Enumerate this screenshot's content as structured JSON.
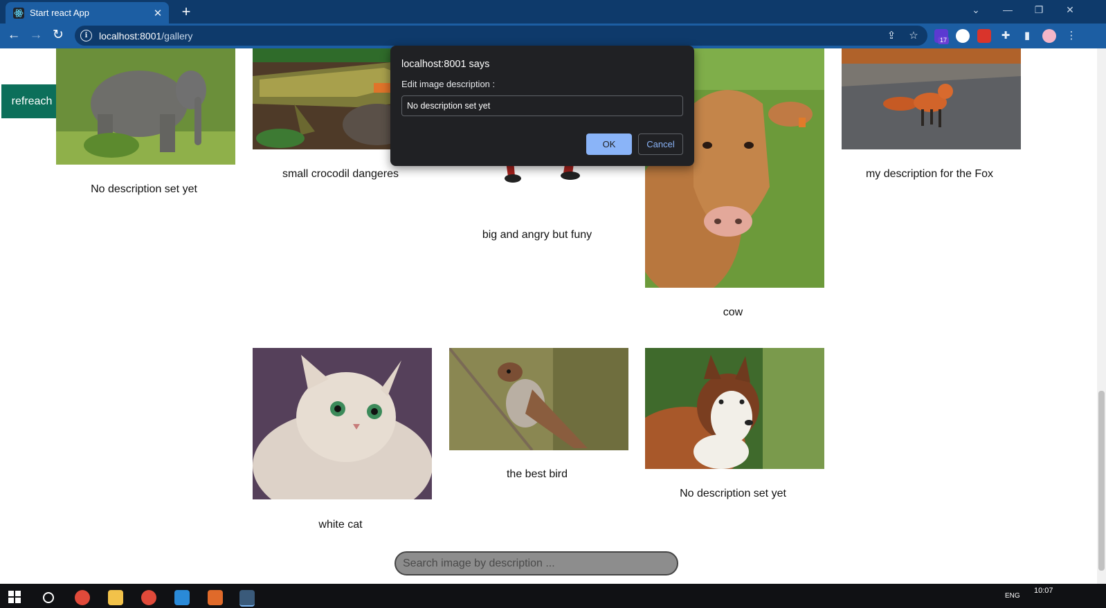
{
  "browser": {
    "tab_title": "Start react App",
    "tab_close": "✕",
    "new_tab": "+",
    "url_host": "localhost:8001",
    "url_path": "/gallery",
    "extension_badge": "17"
  },
  "page": {
    "refresh_label": "refreach",
    "search_placeholder": "Search image by description ...",
    "gallery": [
      {
        "caption": "No description set yet",
        "subject": "elephant"
      },
      {
        "caption": "small crocodil dangeres",
        "subject": "crocodile"
      },
      {
        "caption": "big and angry but funy",
        "subject": "cartoon"
      },
      {
        "caption": "cow",
        "subject": "cow"
      },
      {
        "caption": "my description for the Fox",
        "subject": "fox"
      },
      {
        "caption": "white cat",
        "subject": "cat"
      },
      {
        "caption": "the best bird",
        "subject": "sparrow"
      },
      {
        "caption": "No description set yet",
        "subject": "husky"
      }
    ]
  },
  "dialog": {
    "title": "localhost:8001 says",
    "message": "Edit image description :",
    "input_value": "No description set yet",
    "ok_label": "OK",
    "cancel_label": "Cancel"
  },
  "taskbar": {
    "clock": "10:07",
    "lang": "ENG"
  },
  "colors": {
    "chrome_dark": "#0e3a6b",
    "chrome_light": "#1c5ea3",
    "refresh_button": "#0c6f5a",
    "dialog_bg": "#202124",
    "dialog_accent": "#8ab4f8"
  }
}
